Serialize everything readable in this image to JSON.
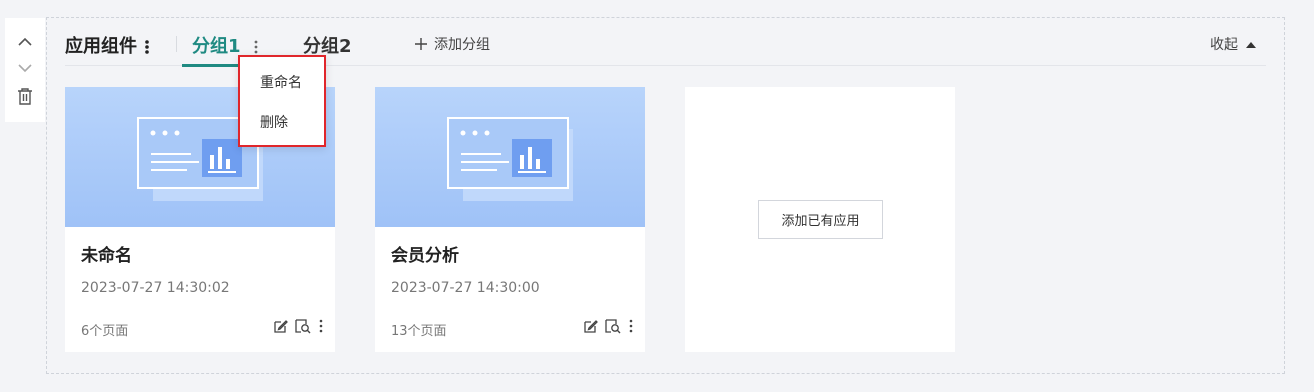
{
  "side_tools": {
    "up_icon": "chevron-up-icon",
    "down_icon": "chevron-down-icon",
    "delete_icon": "trash-icon"
  },
  "header": {
    "title": "应用组件",
    "tabs": [
      {
        "label": "分组1",
        "active": true
      },
      {
        "label": "分组2",
        "active": false
      }
    ],
    "add_group_label": "添加分组",
    "collapse_label": "收起"
  },
  "tab_menu": {
    "items": [
      {
        "label": "重命名"
      },
      {
        "label": "删除"
      }
    ]
  },
  "cards": [
    {
      "name": "未命名",
      "time": "2023-07-27 14:30:02",
      "pages": "6个页面"
    },
    {
      "name": "会员分析",
      "time": "2023-07-27 14:30:00",
      "pages": "13个页面"
    }
  ],
  "add_card": {
    "button_label": "添加已有应用"
  },
  "colors": {
    "accent": "#1f8a82",
    "menu_highlight_border": "#e0262b",
    "thumb_blue": "#9fc2f7",
    "background": "#f3f4f7"
  }
}
